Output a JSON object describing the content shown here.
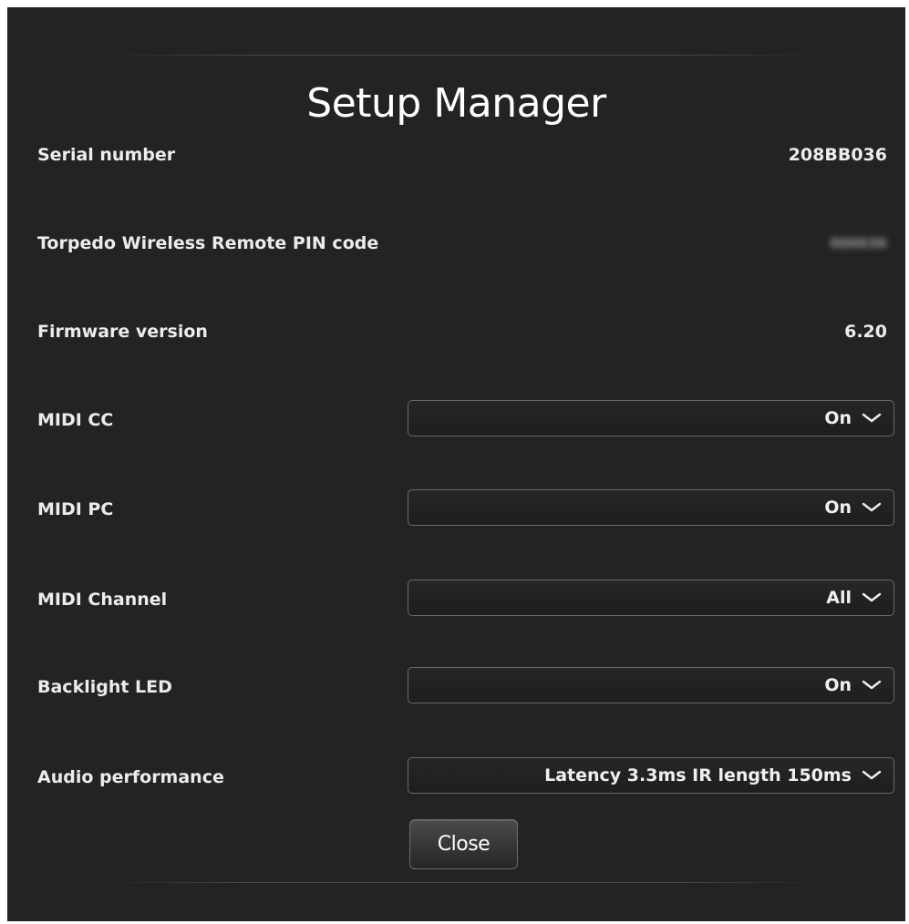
{
  "dialog": {
    "title": "Setup Manager"
  },
  "info": {
    "serial_label": "Serial number",
    "serial_value": "208BB036",
    "pin_label": "Torpedo Wireless Remote PIN code",
    "pin_value": "000036",
    "firmware_label": "Firmware version",
    "firmware_value": "6.20"
  },
  "settings": {
    "midi_cc_label": "MIDI CC",
    "midi_cc_value": "On",
    "midi_pc_label": "MIDI PC",
    "midi_pc_value": "On",
    "midi_channel_label": "MIDI Channel",
    "midi_channel_value": "All",
    "backlight_label": "Backlight LED",
    "backlight_value": "On",
    "audio_label": "Audio performance",
    "audio_value": "Latency 3.3ms IR length 150ms"
  },
  "buttons": {
    "close_label": "Close"
  },
  "icons": {
    "dropdown": "chevron-down-icon"
  },
  "colors": {
    "background": "#232323",
    "text": "#ececec",
    "border": "#6a6a6a"
  }
}
